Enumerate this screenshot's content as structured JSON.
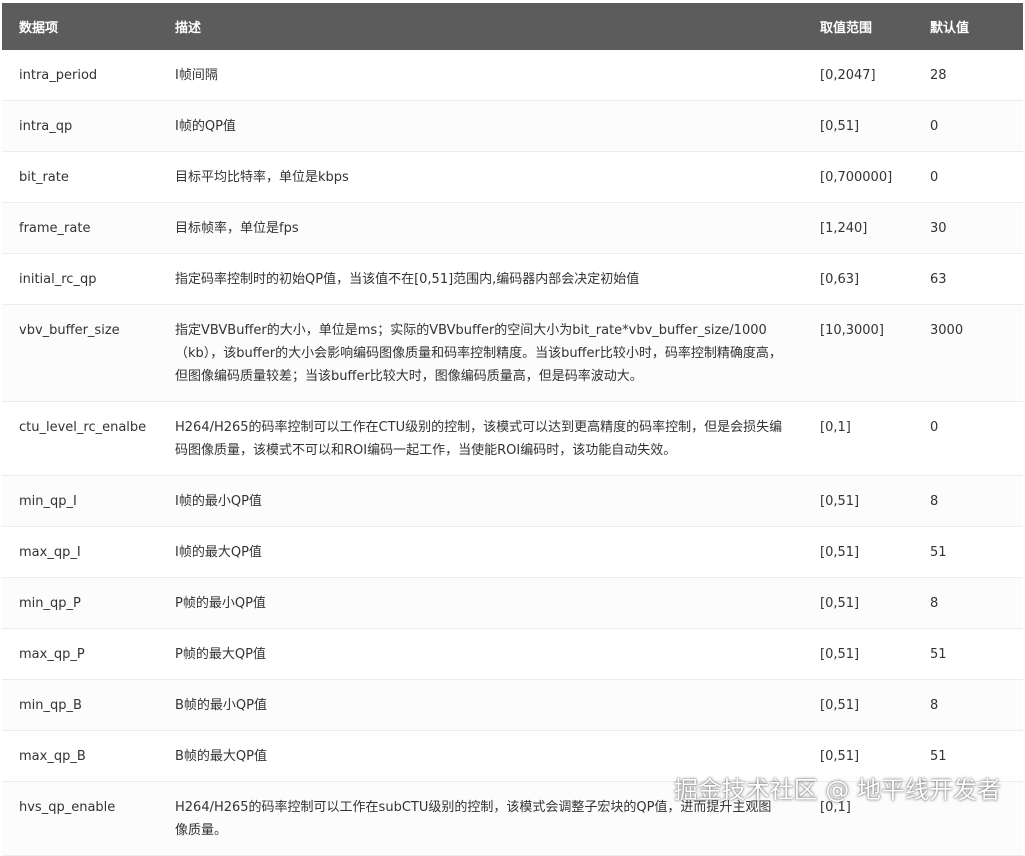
{
  "table": {
    "headers": [
      "数据项",
      "描述",
      "取值范围",
      "默认值"
    ],
    "rows": [
      {
        "name": "intra_period",
        "desc": "I帧间隔",
        "range": "[0,2047]",
        "default": "28"
      },
      {
        "name": "intra_qp",
        "desc": "I帧的QP值",
        "range": "[0,51]",
        "default": "0"
      },
      {
        "name": "bit_rate",
        "desc": "目标平均比特率，单位是kbps",
        "range": "[0,700000]",
        "default": "0"
      },
      {
        "name": "frame_rate",
        "desc": "目标帧率，单位是fps",
        "range": "[1,240]",
        "default": "30"
      },
      {
        "name": "initial_rc_qp",
        "desc": "指定码率控制时的初始QP值，当该值不在[0,51]范围内,编码器内部会决定初始值",
        "range": "[0,63]",
        "default": "63"
      },
      {
        "name": "vbv_buffer_size",
        "desc": "指定VBVBuffer的大小，单位是ms；实际的VBVbuffer的空间大小为bit_rate*vbv_buffer_size/1000（kb），该buffer的大小会影响编码图像质量和码率控制精度。当该buffer比较小时，码率控制精确度高，但图像编码质量较差；当该buffer比较大时，图像编码质量高，但是码率波动大。",
        "range": "[10,3000]",
        "default": "3000"
      },
      {
        "name": "ctu_level_rc_enalbe",
        "desc": "H264/H265的码率控制可以工作在CTU级别的控制，该模式可以达到更高精度的码率控制，但是会损失编码图像质量，该模式不可以和ROI编码一起工作，当使能ROI编码时，该功能自动失效。",
        "range": "[0,1]",
        "default": "0"
      },
      {
        "name": "min_qp_I",
        "desc": "I帧的最小QP值",
        "range": "[0,51]",
        "default": "8"
      },
      {
        "name": "max_qp_I",
        "desc": "I帧的最大QP值",
        "range": "[0,51]",
        "default": "51"
      },
      {
        "name": "min_qp_P",
        "desc": "P帧的最小QP值",
        "range": "[0,51]",
        "default": "8"
      },
      {
        "name": "max_qp_P",
        "desc": "P帧的最大QP值",
        "range": "[0,51]",
        "default": "51"
      },
      {
        "name": "min_qp_B",
        "desc": "B帧的最小QP值",
        "range": "[0,51]",
        "default": "8"
      },
      {
        "name": "max_qp_B",
        "desc": "B帧的最大QP值",
        "range": "[0,51]",
        "default": "51"
      },
      {
        "name": "hvs_qp_enable",
        "desc": "H264/H265的码率控制可以工作在subCTU级别的控制，该模式会调整子宏块的QP值，进而提升主观图像质量。",
        "range": "[0,1]",
        "default": ""
      }
    ]
  },
  "watermark": "掘金技术社区 @ 地平线开发者"
}
